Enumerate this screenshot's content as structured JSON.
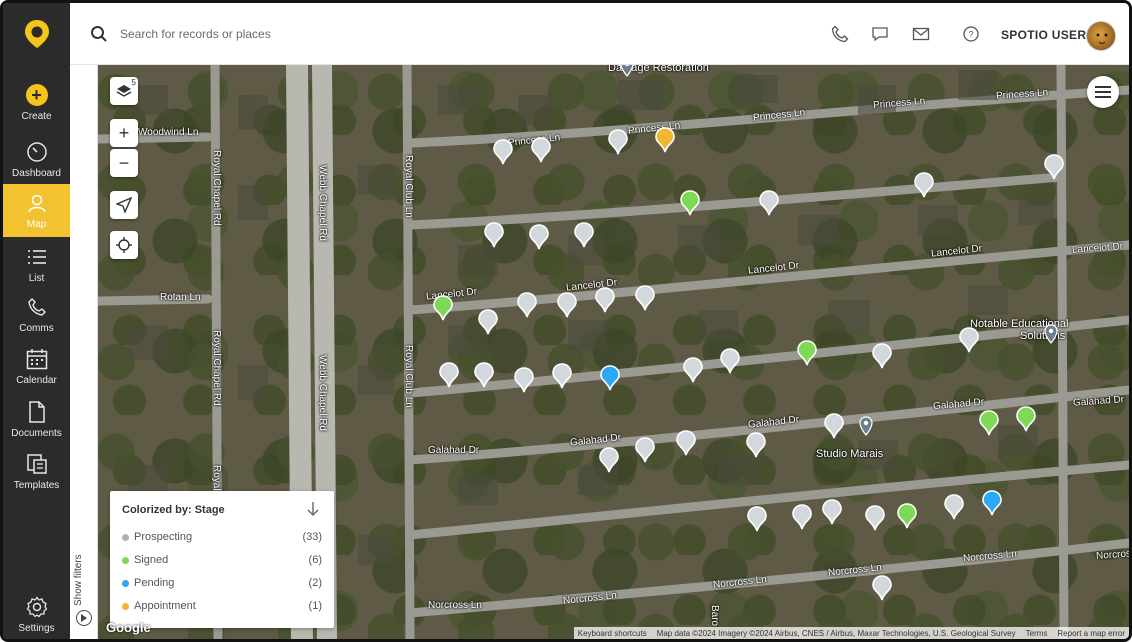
{
  "sidebar": {
    "items": [
      {
        "label": "Create",
        "icon": "plus-icon"
      },
      {
        "label": "Dashboard",
        "icon": "gauge-icon"
      },
      {
        "label": "Map",
        "icon": "person-pin-icon",
        "active": true
      },
      {
        "label": "List",
        "icon": "list-icon"
      },
      {
        "label": "Comms",
        "icon": "phone-icon"
      },
      {
        "label": "Calendar",
        "icon": "calendar-icon"
      },
      {
        "label": "Documents",
        "icon": "document-icon"
      },
      {
        "label": "Templates",
        "icon": "templates-icon"
      },
      {
        "label": "Settings",
        "icon": "gear-icon"
      }
    ]
  },
  "header": {
    "search_placeholder": "Search for records or places",
    "user_name": "SPOTIO USER"
  },
  "filters": {
    "label": "Show filters"
  },
  "map": {
    "layers_count": "5",
    "streets": [
      "Woodwind Ln",
      "Rotan Ln",
      "Royal Chapel Rd",
      "Royal Chapel Rd",
      "Royal Chapel Rd",
      "Webb Chapel Rd",
      "Webb Chapel Rd",
      "Royal Club Ln",
      "Royal Club Ln",
      "Princess Ln",
      "Princess Ln",
      "Princess Ln",
      "Princess Ln",
      "Princess Ln",
      "Lancelot Dr",
      "Lancelot Dr",
      "Lancelot Dr",
      "Lancelot Dr",
      "Lancelot Dr",
      "Galahad Dr",
      "Galahad Dr",
      "Galahad Dr",
      "Galahad Dr",
      "Galahad Dr",
      "Norcross Ln",
      "Norcross Ln",
      "Norcross Ln",
      "Norcross Ln",
      "Norcross Ln",
      "Norcross Ln",
      "Baro"
    ],
    "pois": [
      "Damage Restoration",
      "Notable Educational",
      "Solutions",
      "Studio Marais"
    ]
  },
  "legend": {
    "title": "Colorized by: Stage",
    "rows": [
      {
        "label": "Prospecting",
        "count": "(33)",
        "color": "#a9b1b9"
      },
      {
        "label": "Signed",
        "count": "(6)",
        "color": "#7ed957"
      },
      {
        "label": "Pending",
        "count": "(2)",
        "color": "#2ea8f5"
      },
      {
        "label": "Appointment",
        "count": "(1)",
        "color": "#f2b632"
      }
    ]
  },
  "pins": {
    "colors": {
      "prospecting": "#d3d8dd",
      "signed": "#7ed957",
      "pending": "#2ea8f5",
      "appointment": "#f2b632",
      "place": "#6d7f8e"
    }
  },
  "attribution": {
    "google": "Google",
    "shortcuts": "Keyboard shortcuts",
    "map_data": "Map data ©2024 Imagery ©2024 Airbus, CNES / Airbus, Maxar Technologies, U.S. Geological Survey",
    "terms": "Terms",
    "report": "Report a map error"
  },
  "colors": {
    "accent": "#f2c230",
    "sidebar_bg": "#2b2b2b"
  }
}
